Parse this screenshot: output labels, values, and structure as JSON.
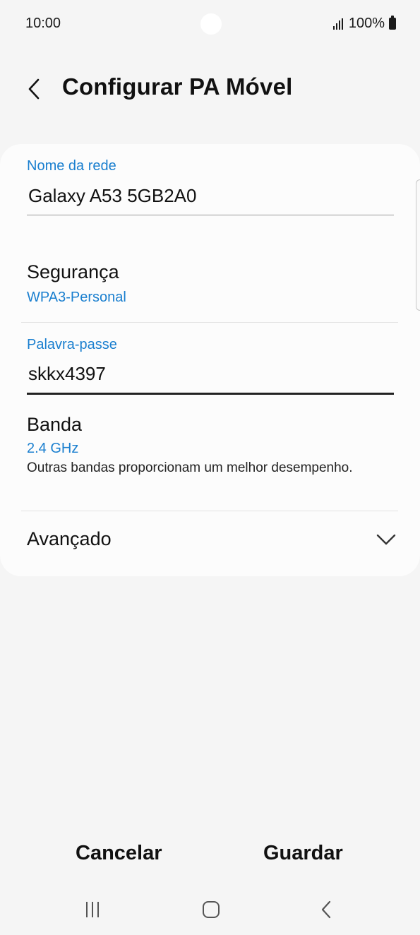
{
  "status_bar": {
    "time": "10:00",
    "battery": "100%",
    "icons": [
      "signal-icon",
      "battery-icon"
    ]
  },
  "header": {
    "back_icon": "chevron-left-icon",
    "title": "Configurar PA Móvel"
  },
  "form": {
    "network_name": {
      "label": "Nome da rede",
      "value": "Galaxy A53 5GB2A0"
    },
    "security": {
      "title": "Segurança",
      "value": "WPA3-Personal"
    },
    "password": {
      "label": "Palavra-passe",
      "value": "skkx4397"
    },
    "band": {
      "title": "Banda",
      "value": "2.4 GHz",
      "description": "Outras bandas proporcionam um melhor desempenho."
    },
    "advanced": {
      "title": "Avançado",
      "icon": "chevron-down-icon"
    }
  },
  "actions": {
    "cancel": "Cancelar",
    "save": "Guardar"
  },
  "nav_bar": {
    "icons": [
      "recent-apps-icon",
      "home-icon",
      "back-icon"
    ]
  },
  "colors": {
    "accent": "#1a7fcf",
    "background": "#f5f5f5",
    "card": "#fcfcfc"
  }
}
